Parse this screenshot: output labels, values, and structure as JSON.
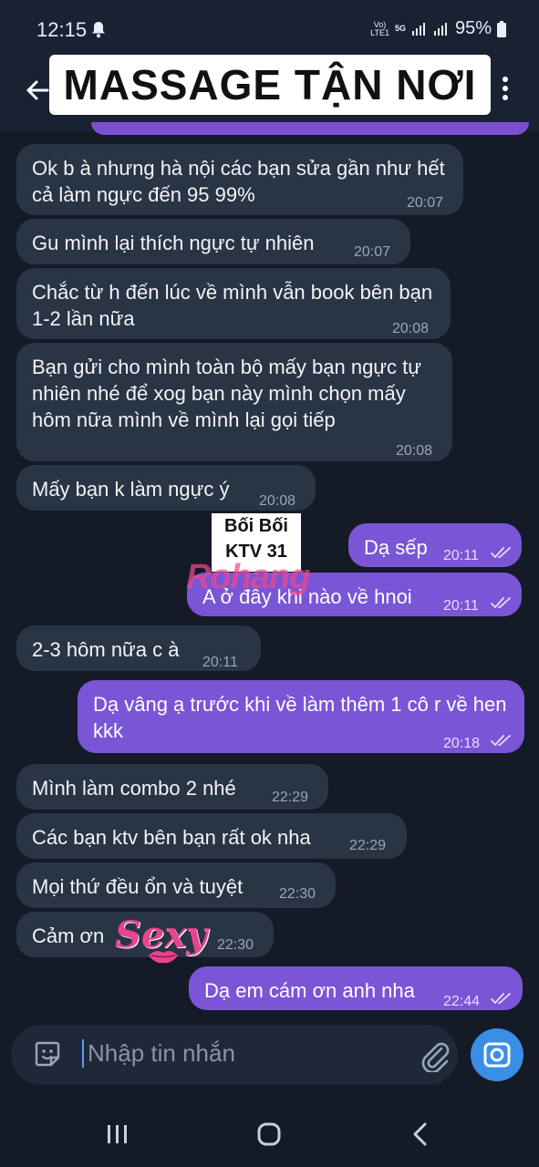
{
  "status": {
    "time": "12:15",
    "network_top": "Vo)",
    "network_bottom": "LTE1",
    "gen": "5G",
    "battery": "95%"
  },
  "header": {
    "title": "MASSAGE TẬN NƠI"
  },
  "overlays": {
    "sticker_line1": "Bối Bối",
    "sticker_line2": "KTV 31",
    "watermark": "Rohang",
    "sexy_sticker": "Sexy"
  },
  "messages": [
    {
      "dir": "in",
      "text": "Ok b à nhưng hà nội các bạn sửa gần như hết cả làm ngực đến 95 99%",
      "time": "20:07"
    },
    {
      "dir": "in",
      "text": "Gu mình lại thích ngực tự nhiên",
      "time": "20:07"
    },
    {
      "dir": "in",
      "text": "Chắc từ h đến lúc về mình vẫn book bên bạn 1-2 lần nữa",
      "time": "20:08"
    },
    {
      "dir": "in",
      "text": "Bạn gửi cho mình toàn bộ mấy bạn ngực tự nhiên nhé để xog bạn này mình chọn mấy hôm nữa mình về mình lại gọi tiếp",
      "time": "20:08"
    },
    {
      "dir": "in",
      "text": "Mấy bạn k làm ngực ý",
      "time": "20:08"
    },
    {
      "dir": "out",
      "text": "Dạ sếp",
      "time": "20:11"
    },
    {
      "dir": "out",
      "text": "A ở đây khi nào về hnoi",
      "time": "20:11"
    },
    {
      "dir": "in",
      "text": "2-3 hôm nữa c à",
      "time": "20:11"
    },
    {
      "dir": "out",
      "text": "Dạ vâng ạ trước khi về làm thêm 1 cô r về hen kkk",
      "time": "20:18"
    },
    {
      "dir": "in",
      "text": "Mình làm combo 2 nhé",
      "time": "22:29"
    },
    {
      "dir": "in",
      "text": "Các bạn ktv bên bạn rất ok nha",
      "time": "22:29"
    },
    {
      "dir": "in",
      "text": "Mọi thứ đều ổn và tuyệt",
      "time": "22:30"
    },
    {
      "dir": "in",
      "text": "Cảm ơn",
      "time": "22:30"
    },
    {
      "dir": "out",
      "text": "Dạ em cám ơn anh nha",
      "time": "22:44"
    }
  ],
  "input": {
    "placeholder": "Nhập tin nhắn"
  },
  "icons": {
    "back": "arrow-left-icon",
    "menu": "kebab-menu-icon",
    "emoji": "sticker-icon",
    "attach": "paperclip-icon",
    "camera": "camera-icon",
    "nav_recents": "recents-icon",
    "nav_home": "home-icon",
    "nav_back": "nav-back-icon"
  },
  "colors": {
    "background": "#141a26",
    "incoming_bubble": "#293444",
    "outgoing_bubble": "#7a55d6",
    "accent": "#3a8ee6"
  }
}
